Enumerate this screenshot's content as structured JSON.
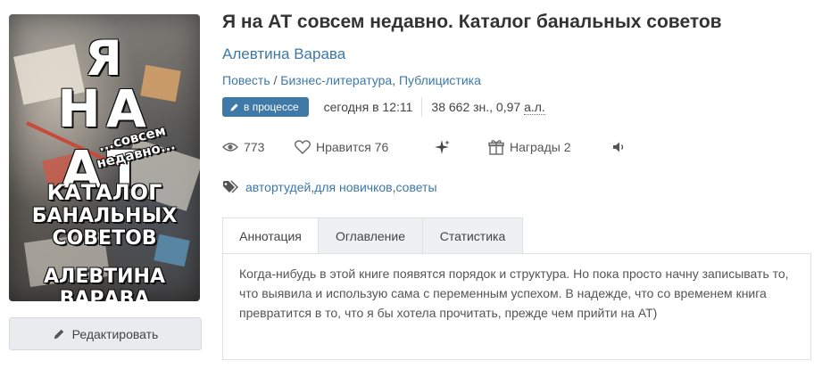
{
  "cover": {
    "line1": "Я",
    "line2": "НА АТ",
    "line3": "...совсем недавно...",
    "line4": "КАТАЛОГ",
    "line5": "БАНАЛЬНЫХ СОВЕТОВ",
    "author": "АЛЕВТИНА ВАРАВА"
  },
  "edit_label": "Редактировать",
  "book": {
    "title": "Я на АТ совсем недавно. Каталог банальных советов",
    "author": "Алевтина Варава",
    "genre_1": "Повесть",
    "genre_sep": " / ",
    "genre_2": "Бизнес-литература",
    "genre_comma": ", ",
    "genre_3": "Публицистика",
    "status": "в процессе",
    "updated": "сегодня в 12:11",
    "size_chars": "38 662 зн., 0,97 ",
    "size_unit": "а.л."
  },
  "stats": {
    "views": "773",
    "likes_label": "Нравится",
    "likes": "76",
    "awards_label": "Награды",
    "awards": "2"
  },
  "tags": [
    "автортудей",
    "для новичков",
    "советы"
  ],
  "tags_sep": ", ",
  "tabs": [
    "Аннотация",
    "Оглавление",
    "Статистика"
  ],
  "annotation": "Когда-нибудь в этой книге появятся порядок и структура. Но пока просто начну записывать то, что выявила и использую сама с переменным успехом. В надежде, что со временем книга превратится в то, что я бы хотела прочитать, прежде чем прийти на АТ)",
  "colors": {
    "link": "#3d78a8",
    "badge": "#3e79a8"
  }
}
